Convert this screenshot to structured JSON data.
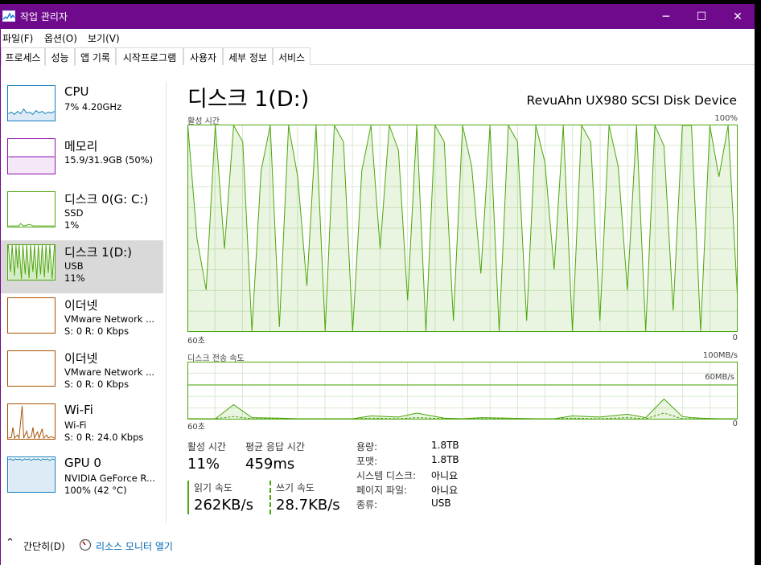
{
  "window": {
    "title": "작업 관리자",
    "controls": {
      "minimize": "─",
      "maximize": "☐",
      "close": "✕"
    }
  },
  "menu": [
    "파일(F)",
    "옵션(O)",
    "보기(V)"
  ],
  "tabs": [
    "프로세스",
    "성능",
    "앱 기록",
    "시작프로그램",
    "사용자",
    "세부 정보",
    "서비스"
  ],
  "active_tab": "성능",
  "sidebar": {
    "items": [
      {
        "name": "CPU",
        "line1": "7% 4.20GHz",
        "line2": "",
        "color": "#117dbb"
      },
      {
        "name": "메모리",
        "line1": "15.9/31.9GB (50%)",
        "line2": "",
        "color": "#8b12ae"
      },
      {
        "name": "디스크 0(G: C:)",
        "line1": "SSD",
        "line2": "1%",
        "color": "#4da60c"
      },
      {
        "name": "디스크 1(D:)",
        "line1": "USB",
        "line2": "11%",
        "color": "#4da60c"
      },
      {
        "name": "이더넷",
        "line1": "VMware Network ...",
        "line2": "S: 0 R: 0 Kbps",
        "color": "#a74f01"
      },
      {
        "name": "이더넷",
        "line1": "VMware Network ...",
        "line2": "S: 0 R: 0 Kbps",
        "color": "#a74f01"
      },
      {
        "name": "Wi-Fi",
        "line1": "Wi-Fi",
        "line2": "S: 0 R: 24.0 Kbps",
        "color": "#a74f01"
      },
      {
        "name": "GPU 0",
        "line1": "NVIDIA GeForce R...",
        "line2": "100% (42 °C)",
        "color": "#117dbb"
      }
    ],
    "selected_index": 3
  },
  "main": {
    "title": "디스크 1(D:)",
    "device": "RevuAhn UX980 SCSI Disk Device",
    "chart1_label": "활성 시간",
    "chart1_max": "100%",
    "chart1_time_left": "60초",
    "chart1_time_right": "0",
    "chart2_label": "디스크 전송 속도",
    "chart2_max": "100MB/s",
    "chart2_mid": "60MB/s",
    "chart2_time_left": "60초",
    "chart2_time_right": "0"
  },
  "stats": {
    "active_time_label": "활성 시간",
    "active_time_value": "11%",
    "avg_response_label": "평균 응답 시간",
    "avg_response_value": "459ms",
    "read_label": "읽기 속도",
    "read_value": "262KB/s",
    "write_label": "쓰기 속도",
    "write_value": "28.7KB/s"
  },
  "properties": [
    {
      "label": "용량:",
      "value": "1.8TB"
    },
    {
      "label": "포맷:",
      "value": "1.8TB"
    },
    {
      "label": "시스템 디스크:",
      "value": "아니요"
    },
    {
      "label": "페이지 파일:",
      "value": "아니요"
    },
    {
      "label": "종류:",
      "value": "USB"
    }
  ],
  "footer": {
    "collapse_label": "간단히(D)",
    "resource_monitor_label": "리소스 모니터 열기"
  },
  "chart_data": [
    {
      "type": "area",
      "title": "활성 시간",
      "ylabel": "",
      "ylim": [
        0,
        100
      ],
      "x": [
        60,
        59,
        58,
        57,
        56,
        55,
        54,
        53,
        52,
        51,
        50,
        49,
        48,
        47,
        46,
        45,
        44,
        43,
        42,
        41,
        40,
        39,
        38,
        37,
        36,
        35,
        34,
        33,
        32,
        31,
        30,
        29,
        28,
        27,
        26,
        25,
        24,
        23,
        22,
        21,
        20,
        19,
        18,
        17,
        16,
        15,
        14,
        13,
        12,
        11,
        10,
        9,
        8,
        7,
        6,
        5,
        4,
        3,
        2,
        1,
        0
      ],
      "values": [
        100,
        45,
        20,
        100,
        40,
        100,
        92,
        0,
        78,
        100,
        2,
        100,
        75,
        22,
        100,
        0,
        100,
        92,
        0,
        78,
        100,
        40,
        100,
        88,
        15,
        100,
        0,
        100,
        92,
        5,
        100,
        80,
        28,
        100,
        0,
        100,
        92,
        5,
        100,
        82,
        30,
        100,
        0,
        100,
        92,
        5,
        100,
        80,
        20,
        100,
        0,
        100,
        90,
        10,
        100,
        100,
        0,
        100,
        75,
        100,
        18
      ],
      "series_color": "#4da60c"
    },
    {
      "type": "line",
      "title": "디스크 전송 속도",
      "ylabel": "",
      "ylim": [
        0,
        100
      ],
      "unit": "MB/s",
      "x": [
        60,
        57,
        55,
        53,
        50,
        48,
        45,
        42,
        40,
        37,
        35,
        32,
        30,
        28,
        25,
        22,
        20,
        18,
        15,
        12,
        10,
        8,
        6,
        5,
        4,
        2,
        0
      ],
      "series": [
        {
          "values": [
            0,
            0,
            25,
            2,
            1,
            0,
            0,
            0,
            5,
            3,
            10,
            1,
            0,
            2,
            1,
            0,
            0,
            5,
            3,
            8,
            2,
            35,
            4,
            2,
            1,
            0,
            0
          ]
        },
        {
          "values": [
            0,
            0,
            4,
            0,
            0,
            0,
            0,
            0,
            1,
            0,
            2,
            0,
            0,
            0,
            0,
            0,
            0,
            1,
            0,
            2,
            0,
            10,
            0,
            0,
            0,
            0,
            0
          ]
        }
      ],
      "series_color": "#4da60c"
    }
  ]
}
